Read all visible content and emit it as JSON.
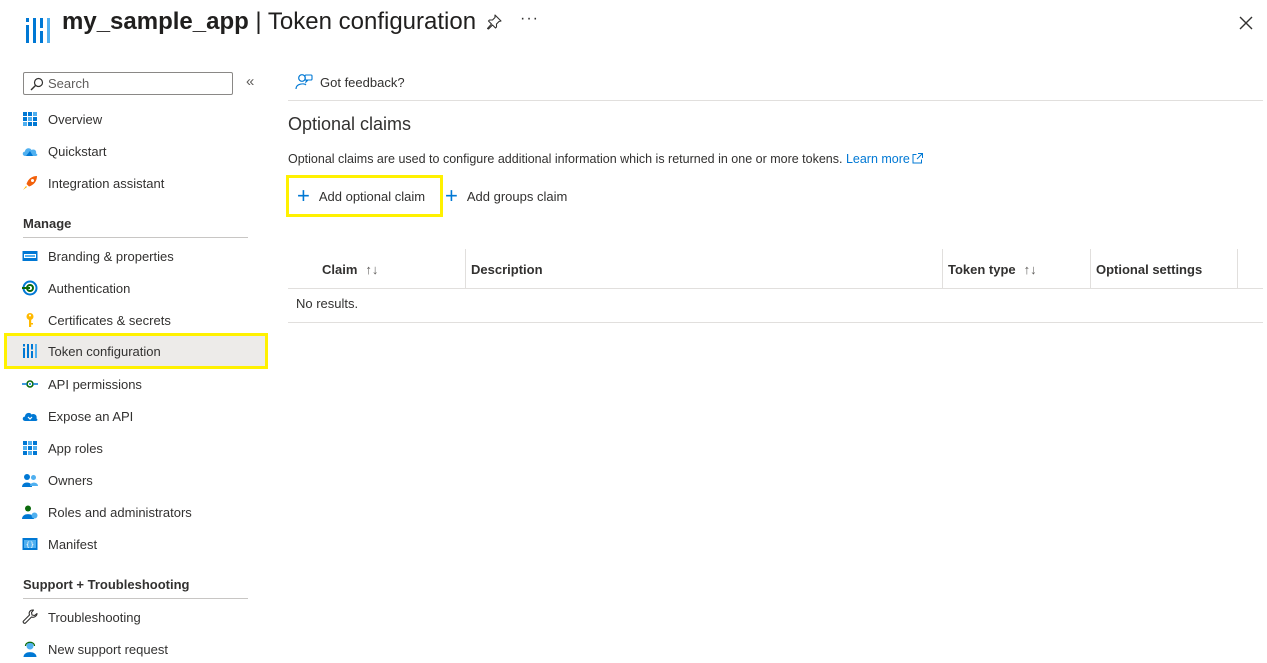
{
  "header": {
    "app_name": "my_sample_app",
    "separator": " | ",
    "page_title": "Token configuration",
    "more_label": "···"
  },
  "sidebar": {
    "search_placeholder": "Search",
    "collapse_label": "«",
    "top_items": [
      {
        "label": "Overview",
        "icon": "overview-grid-icon"
      },
      {
        "label": "Quickstart",
        "icon": "quickstart-cloud-icon"
      },
      {
        "label": "Integration assistant",
        "icon": "rocket-icon"
      }
    ],
    "manage_header": "Manage",
    "manage_items": [
      {
        "label": "Branding & properties",
        "icon": "branding-icon"
      },
      {
        "label": "Authentication",
        "icon": "authentication-icon"
      },
      {
        "label": "Certificates & secrets",
        "icon": "key-icon"
      },
      {
        "label": "Token configuration",
        "icon": "token-bars-icon",
        "active": true
      },
      {
        "label": "API permissions",
        "icon": "api-permissions-icon"
      },
      {
        "label": "Expose an API",
        "icon": "cloud-api-icon"
      },
      {
        "label": "App roles",
        "icon": "app-roles-grid-icon"
      },
      {
        "label": "Owners",
        "icon": "owners-people-icon"
      },
      {
        "label": "Roles and administrators",
        "icon": "roles-admin-icon"
      },
      {
        "label": "Manifest",
        "icon": "manifest-icon"
      }
    ],
    "support_header": "Support + Troubleshooting",
    "support_items": [
      {
        "label": "Troubleshooting",
        "icon": "wrench-icon"
      },
      {
        "label": "New support request",
        "icon": "support-person-icon"
      }
    ]
  },
  "toolbar": {
    "feedback_label": "Got feedback?"
  },
  "optional_claims": {
    "title": "Optional claims",
    "description": "Optional claims are used to configure additional information which is returned in one or more tokens.",
    "learn_more": "Learn more",
    "add_optional_claim": "Add optional claim",
    "add_groups_claim": "Add groups claim"
  },
  "grid": {
    "columns": {
      "claim": "Claim",
      "description": "Description",
      "token_type": "Token type",
      "optional_settings": "Optional settings"
    },
    "sort_claim": "↑↓",
    "sort_token": "↑↓",
    "empty_text": "No results."
  },
  "colors": {
    "accent": "#0078d4",
    "highlight": "#fff100",
    "active_bg": "#edebe9"
  }
}
